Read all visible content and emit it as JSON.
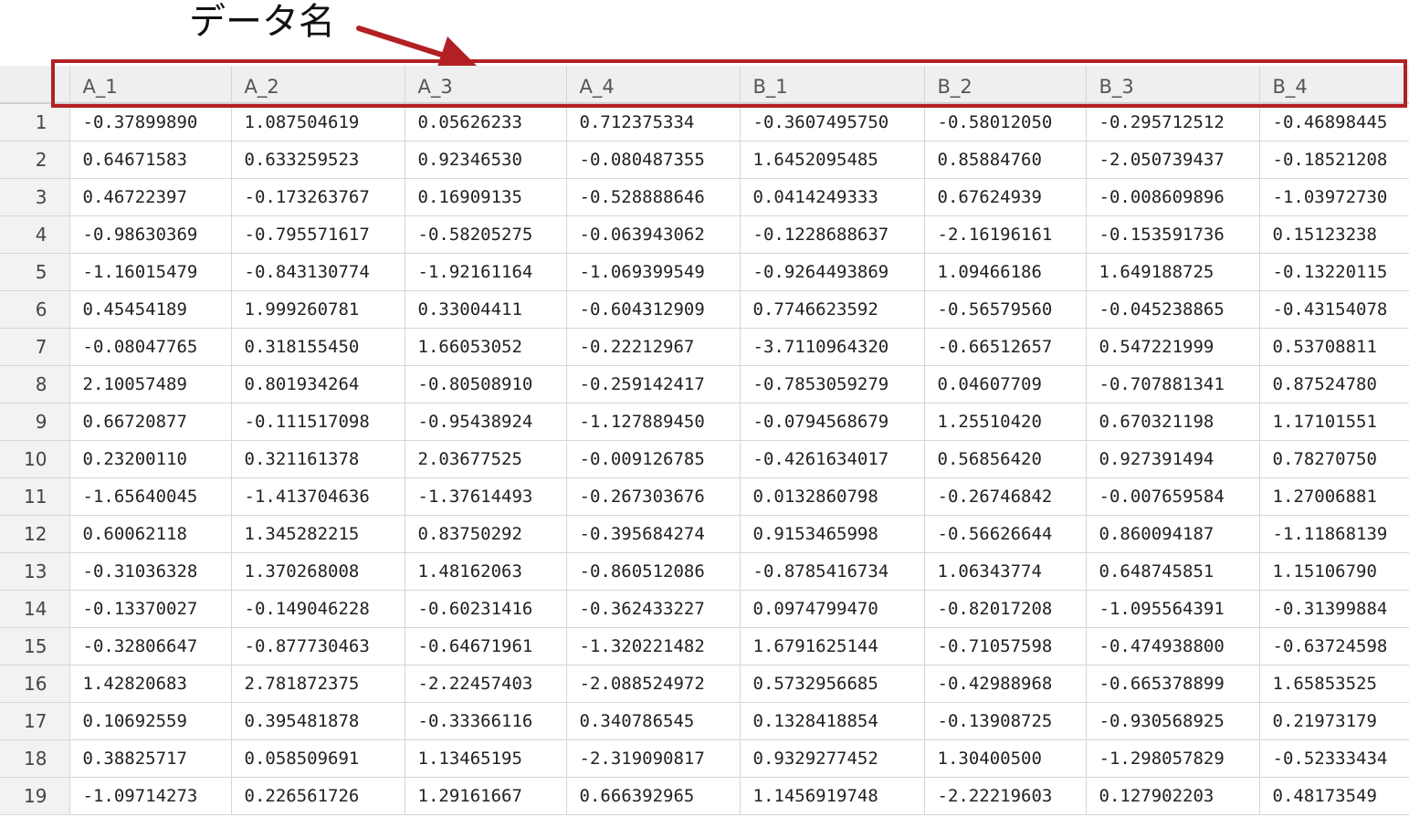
{
  "annotation": {
    "label": "データ名",
    "color": "#b32024"
  },
  "table": {
    "columns": [
      "A_1",
      "A_2",
      "A_3",
      "A_4",
      "B_1",
      "B_2",
      "B_3",
      "B_4"
    ],
    "rows": [
      {
        "num": "1",
        "cells": [
          "-0.37899890",
          "1.087504619",
          "0.05626233",
          "0.712375334",
          "-0.3607495750",
          "-0.58012050",
          "-0.295712512",
          "-0.46898445"
        ]
      },
      {
        "num": "2",
        "cells": [
          "0.64671583",
          "0.633259523",
          "0.92346530",
          "-0.080487355",
          "1.6452095485",
          "0.85884760",
          "-2.050739437",
          "-0.18521208"
        ]
      },
      {
        "num": "3",
        "cells": [
          "0.46722397",
          "-0.173263767",
          "0.16909135",
          "-0.528888646",
          "0.0414249333",
          "0.67624939",
          "-0.008609896",
          "-1.03972730"
        ]
      },
      {
        "num": "4",
        "cells": [
          "-0.98630369",
          "-0.795571617",
          "-0.58205275",
          "-0.063943062",
          "-0.1228688637",
          "-2.16196161",
          "-0.153591736",
          "0.15123238"
        ]
      },
      {
        "num": "5",
        "cells": [
          "-1.16015479",
          "-0.843130774",
          "-1.92161164",
          "-1.069399549",
          "-0.9264493869",
          "1.09466186",
          "1.649188725",
          "-0.13220115"
        ]
      },
      {
        "num": "6",
        "cells": [
          "0.45454189",
          "1.999260781",
          "0.33004411",
          "-0.604312909",
          "0.7746623592",
          "-0.56579560",
          "-0.045238865",
          "-0.43154078"
        ]
      },
      {
        "num": "7",
        "cells": [
          "-0.08047765",
          "0.318155450",
          "1.66053052",
          "-0.22212967",
          "-3.7110964320",
          "-0.66512657",
          "0.547221999",
          "0.53708811"
        ]
      },
      {
        "num": "8",
        "cells": [
          "2.10057489",
          "0.801934264",
          "-0.80508910",
          "-0.259142417",
          "-0.7853059279",
          "0.04607709",
          "-0.707881341",
          "0.87524780"
        ]
      },
      {
        "num": "9",
        "cells": [
          "0.66720877",
          "-0.111517098",
          "-0.95438924",
          "-1.127889450",
          "-0.0794568679",
          "1.25510420",
          "0.670321198",
          "1.17101551"
        ]
      },
      {
        "num": "10",
        "cells": [
          "0.23200110",
          "0.321161378",
          "2.03677525",
          "-0.009126785",
          "-0.4261634017",
          "0.56856420",
          "0.927391494",
          "0.78270750"
        ]
      },
      {
        "num": "11",
        "cells": [
          "-1.65640045",
          "-1.413704636",
          "-1.37614493",
          "-0.267303676",
          "0.0132860798",
          "-0.26746842",
          "-0.007659584",
          "1.27006881"
        ]
      },
      {
        "num": "12",
        "cells": [
          "0.60062118",
          "1.345282215",
          "0.83750292",
          "-0.395684274",
          "0.9153465998",
          "-0.56626644",
          "0.860094187",
          "-1.11868139"
        ]
      },
      {
        "num": "13",
        "cells": [
          "-0.31036328",
          "1.370268008",
          "1.48162063",
          "-0.860512086",
          "-0.8785416734",
          "1.06343774",
          "0.648745851",
          "1.15106790"
        ]
      },
      {
        "num": "14",
        "cells": [
          "-0.13370027",
          "-0.149046228",
          "-0.60231416",
          "-0.362433227",
          "0.0974799470",
          "-0.82017208",
          "-1.095564391",
          "-0.31399884"
        ]
      },
      {
        "num": "15",
        "cells": [
          "-0.32806647",
          "-0.877730463",
          "-0.64671961",
          "-1.320221482",
          "1.6791625144",
          "-0.71057598",
          "-0.474938800",
          "-0.63724598"
        ]
      },
      {
        "num": "16",
        "cells": [
          "1.42820683",
          "2.781872375",
          "-2.22457403",
          "-2.088524972",
          "0.5732956685",
          "-0.42988968",
          "-0.665378899",
          "1.65853525"
        ]
      },
      {
        "num": "17",
        "cells": [
          "0.10692559",
          "0.395481878",
          "-0.33366116",
          "0.340786545",
          "0.1328418854",
          "-0.13908725",
          "-0.930568925",
          "0.21973179"
        ]
      },
      {
        "num": "18",
        "cells": [
          "0.38825717",
          "0.058509691",
          "1.13465195",
          "-2.319090817",
          "0.9329277452",
          "1.30400500",
          "-1.298057829",
          "-0.52333434"
        ]
      },
      {
        "num": "19",
        "cells": [
          "-1.09714273",
          "0.226561726",
          "1.29161667",
          "0.666392965",
          "1.1456919748",
          "-2.22219603",
          "0.127902203",
          "0.48173549"
        ]
      }
    ]
  }
}
